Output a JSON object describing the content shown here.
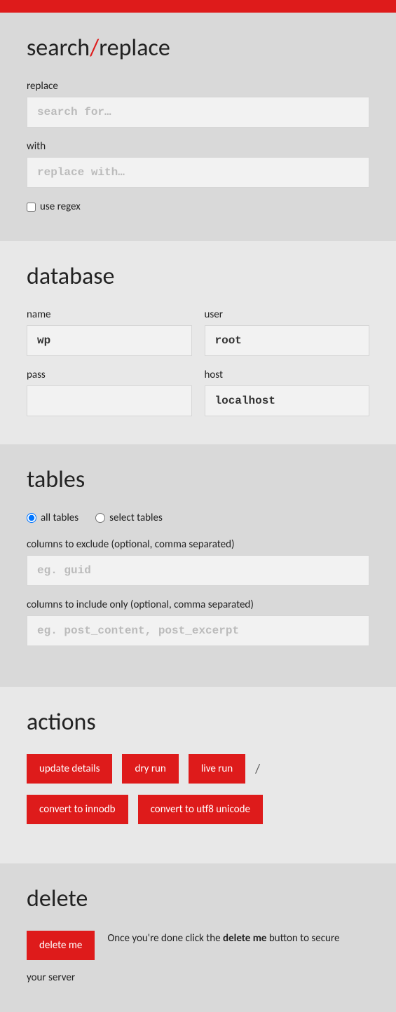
{
  "header": {
    "title_a": "search",
    "title_b": "replace"
  },
  "replace": {
    "label": "replace",
    "search_placeholder": "search for…",
    "with_label": "with",
    "with_placeholder": "replace with…",
    "regex_label": "use regex"
  },
  "database": {
    "heading": "database",
    "name_label": "name",
    "name_value": "wp",
    "user_label": "user",
    "user_value": "root",
    "pass_label": "pass",
    "pass_value": "",
    "host_label": "host",
    "host_value": "localhost"
  },
  "tables": {
    "heading": "tables",
    "all_label": "all tables",
    "select_label": "select tables",
    "exclude_label": "columns to exclude (optional, comma separated)",
    "exclude_placeholder": "eg. guid",
    "include_label": "columns to include only (optional, comma separated)",
    "include_placeholder": "eg. post_content, post_excerpt"
  },
  "actions": {
    "heading": "actions",
    "update": "update details",
    "dry": "dry run",
    "live": "live run",
    "innodb": "convert to innodb",
    "utf8": "convert to utf8 unicode"
  },
  "del": {
    "heading": "delete",
    "button": "delete me",
    "text_a": "Once you're done click the ",
    "text_strong": "delete me",
    "text_b": " button to secure",
    "text_c": "your server"
  }
}
